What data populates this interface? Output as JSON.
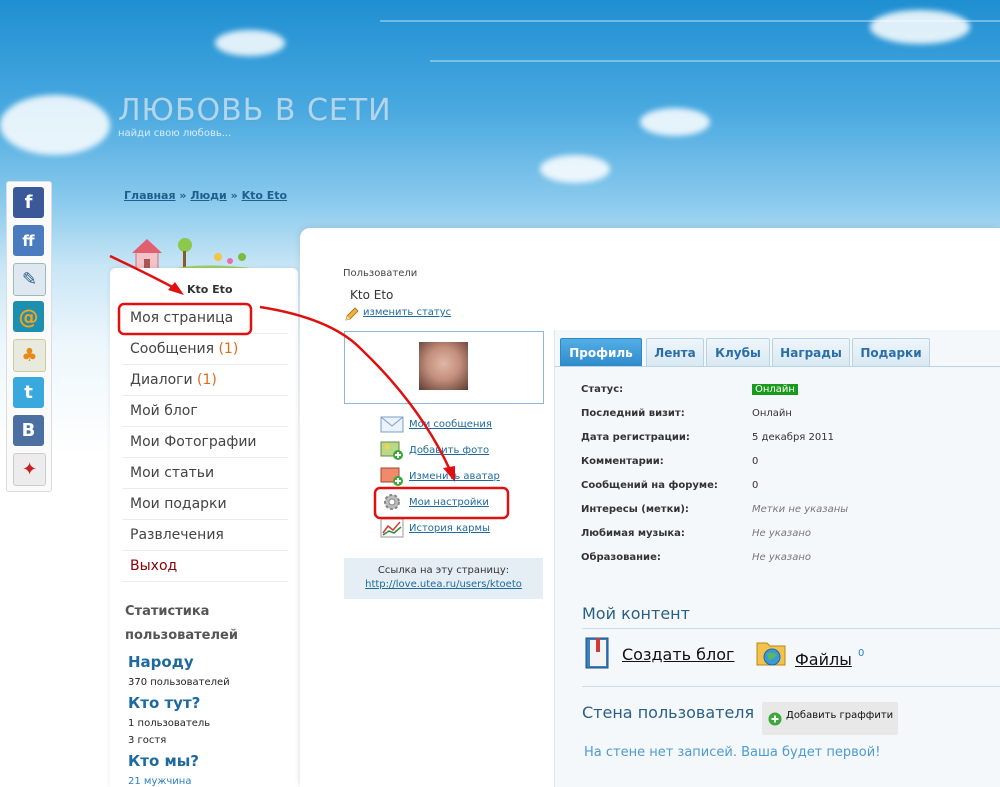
{
  "site": {
    "logo": "ЛЮБОВЬ В СЕТИ",
    "slogan": "найди свою любовь..."
  },
  "breadcrumb": {
    "home": "Главная",
    "sep1": "»",
    "people": "Люди",
    "sep2": "»",
    "current": "Kto Eto"
  },
  "social": {
    "items": [
      {
        "name": "facebook",
        "glyph": "f",
        "color": "#3b5998"
      },
      {
        "name": "friendfeed",
        "glyph": "ff",
        "color": "#4a7bbf"
      },
      {
        "name": "livejournal",
        "glyph": "✎",
        "color": "#dfe8f0"
      },
      {
        "name": "mail-ru",
        "glyph": "@",
        "color": "#1d8fb0"
      },
      {
        "name": "odnoklassniki",
        "glyph": "ꝏ",
        "color": "#e9eadf"
      },
      {
        "name": "twitter",
        "glyph": "t",
        "color": "#39a8dc"
      },
      {
        "name": "vkontakte",
        "glyph": "B",
        "color": "#4a6fa0"
      },
      {
        "name": "moi-krug",
        "glyph": "✦",
        "color": "#e8e8e8"
      }
    ]
  },
  "sidebar": {
    "username": "Kto Eto",
    "menu": {
      "my_page": "Моя страница",
      "messages": "Сообщения",
      "messages_count": "(1)",
      "dialogs": "Диалоги",
      "dialogs_count": "(1)",
      "blog": "Мой блог",
      "photos": "Мои Фотографии",
      "articles": "Мои статьи",
      "gifts": "Мои подарки",
      "fun": "Развлечения",
      "exit": "Выход"
    },
    "stats": {
      "heading": "Статистика пользователей",
      "people_title": "Народу",
      "people_count": "370 пользователей",
      "online_title": "Кто тут?",
      "online_users": "1 пользователь",
      "online_guests": "3 гостя",
      "who_title": "Кто мы?",
      "who_men": "21 мужчина"
    }
  },
  "center": {
    "section": "Пользователи",
    "username": "Kto Eto",
    "change_status": "изменить статус",
    "actions": {
      "messages": "Мои сообщения",
      "add_photo": "Добавить фото",
      "change_avatar": "Изменить аватар",
      "settings": "Мои настройки",
      "karma": "История кармы"
    },
    "link_box": {
      "label": "Ссылка на эту страницу:",
      "url": "http://love.utea.ru/users/ktoeto"
    }
  },
  "profile": {
    "tabs": [
      "Профиль",
      "Лента",
      "Клубы",
      "Награды",
      "Подарки"
    ],
    "rows": {
      "status_k": "Статус:",
      "status_v": "Онлайн",
      "visit_k": "Последний визит:",
      "visit_v": "Онлайн",
      "reg_k": "Дата регистрации:",
      "reg_v": "5 декабря 2011",
      "comments_k": "Комментарии:",
      "comments_v": "0",
      "forum_k": "Сообщений на форуме:",
      "forum_v": "0",
      "interests_k": "Интересы (метки):",
      "interests_v": "Метки не указаны",
      "music_k": "Любимая музыка:",
      "music_v": "Не указано",
      "edu_k": "Образование:",
      "edu_v": "Не указано"
    },
    "my_content": {
      "title": "Мой контент",
      "create_blog": "Создать блог",
      "files": "Файлы",
      "files_count": "0"
    },
    "wall": {
      "title": "Стена пользователя",
      "add_graffiti": "Добавить граффити",
      "empty": "На стене нет записей. Ваша будет первой!"
    }
  },
  "colors": {
    "annotation": "#e01010",
    "link": "#1e6a9e",
    "online": "#1a9a1a"
  }
}
